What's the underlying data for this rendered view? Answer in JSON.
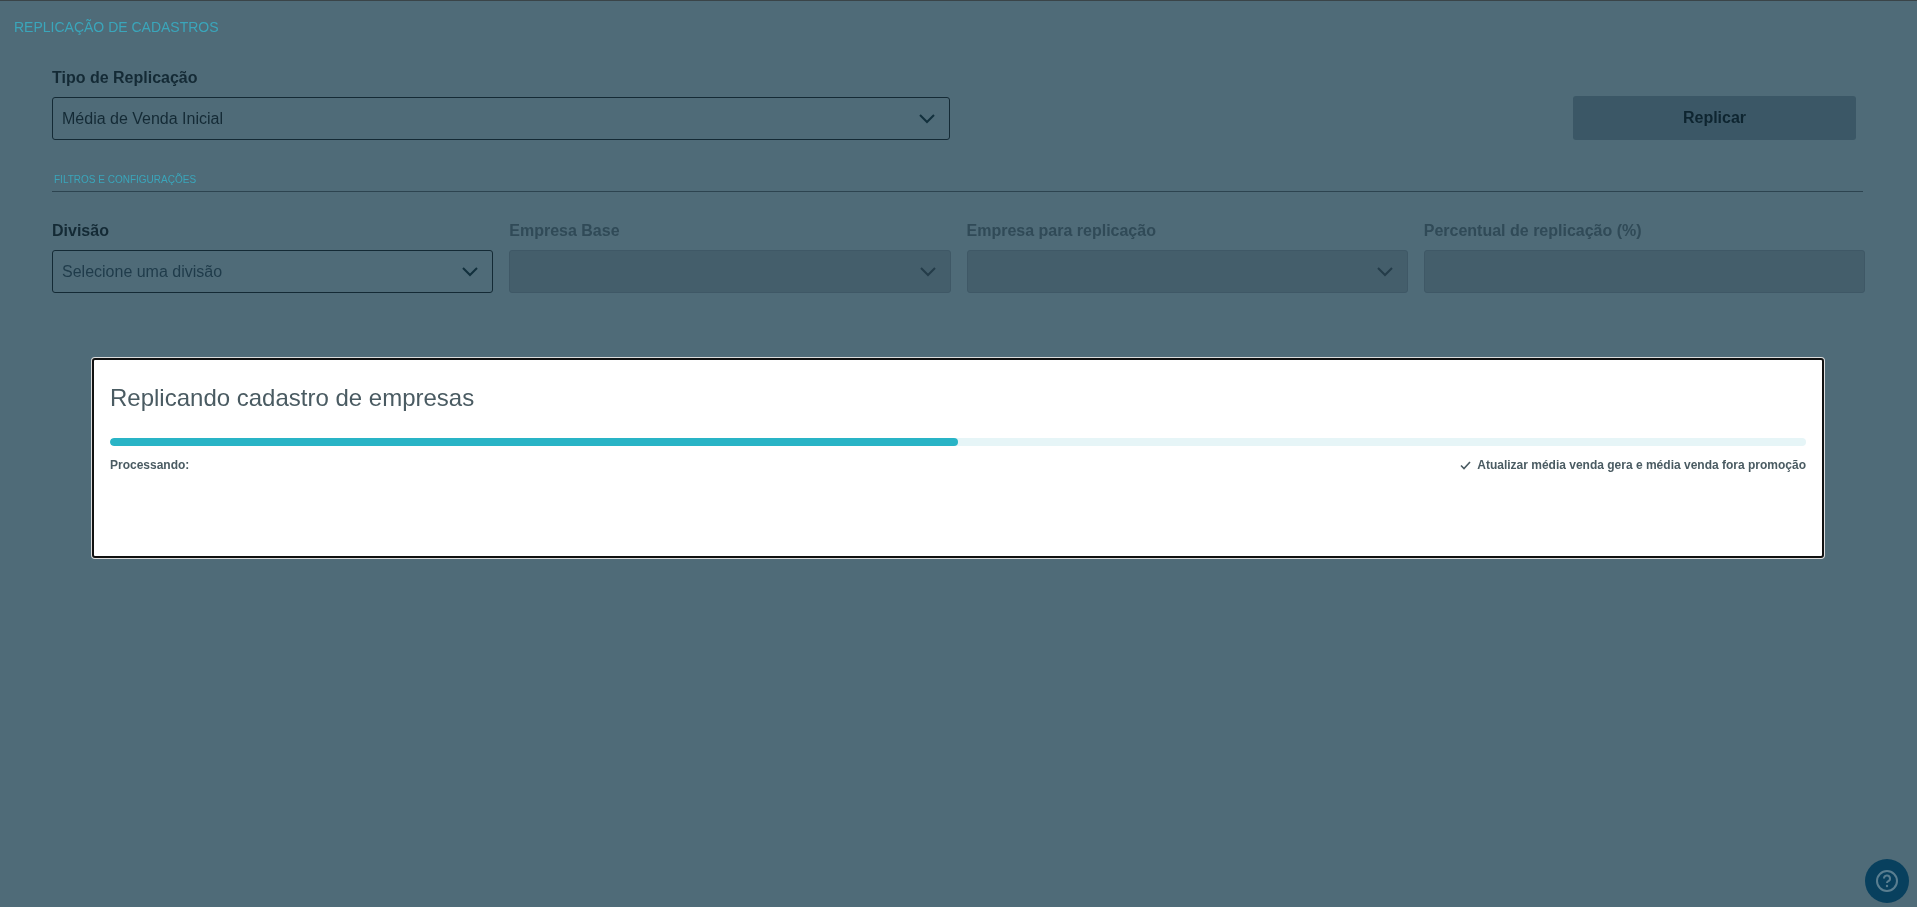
{
  "page_title": "REPLICAÇÃO DE CADASTROS",
  "replication_type": {
    "label": "Tipo de Replicação",
    "value": "Média de Venda Inicial"
  },
  "replicate_button": {
    "label": "Replicar",
    "disabled": true
  },
  "section_label": "FILTROS E CONFIGURAÇÕES",
  "filters": [
    {
      "kind": "select",
      "label": "Divisão",
      "placeholder": "Selecione uma divisão",
      "disabled": false
    },
    {
      "kind": "select",
      "label": "Empresa Base",
      "disabled": true
    },
    {
      "kind": "select",
      "label": "Empresa para replicação",
      "disabled": true
    },
    {
      "kind": "input",
      "label": "Percentual de replicação (%)",
      "disabled": true
    }
  ],
  "modal": {
    "title": "Replicando cadastro de empresas",
    "level": 0.5,
    "status_label": "Processando:",
    "steps": [
      {
        "text": "Atualizar média venda gera e média venda fora promoção",
        "done": true
      }
    ]
  }
}
